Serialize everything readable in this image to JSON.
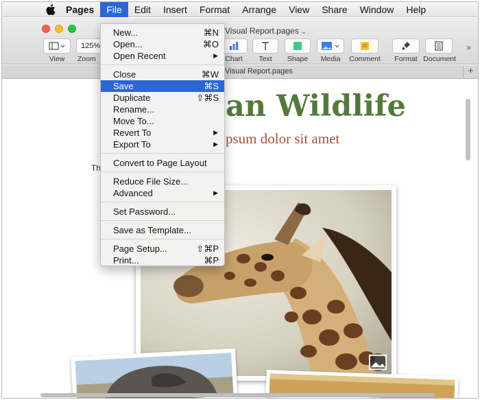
{
  "menubar": {
    "apple_icon": "apple-icon",
    "app_name": "Pages",
    "items": [
      "File",
      "Edit",
      "Insert",
      "Format",
      "Arrange",
      "View",
      "Share",
      "Window",
      "Help"
    ],
    "active": "File"
  },
  "window": {
    "title": "Visual Report.pages",
    "title_chevron": "chevron-down-icon",
    "tab_title": "Visual Report.pages"
  },
  "toolbar": {
    "view_label": "View",
    "zoom_value": "125%",
    "zoom_label": "Zoom",
    "chart_label": "Chart",
    "text_label": "Text",
    "shape_label": "Shape",
    "media_label": "Media",
    "comment_label": "Comment",
    "format_label": "Format",
    "document_label": "Document",
    "more_glyph": "»",
    "accent_color": "#2b66d6"
  },
  "file_menu": {
    "groups": [
      [
        {
          "label": "New...",
          "shortcut": "⌘N"
        },
        {
          "label": "Open...",
          "shortcut": "⌘O"
        },
        {
          "label": "Open Recent",
          "submenu": "▶"
        }
      ],
      [
        {
          "label": "Close",
          "shortcut": "⌘W"
        },
        {
          "label": "Save",
          "shortcut": "⌘S",
          "highlighted": true
        },
        {
          "label": "Duplicate",
          "shortcut": "⇧⌘S"
        },
        {
          "label": "Rename..."
        },
        {
          "label": "Move To..."
        },
        {
          "label": "Revert To",
          "submenu": "▶"
        },
        {
          "label": "Export To",
          "submenu": "▶"
        }
      ],
      [
        {
          "label": "Convert to Page Layout"
        }
      ],
      [
        {
          "label": "Reduce File Size..."
        },
        {
          "label": "Advanced",
          "submenu": "▶"
        }
      ],
      [
        {
          "label": "Set Password..."
        }
      ],
      [
        {
          "label": "Save as Template..."
        }
      ],
      [
        {
          "label": "Page Setup...",
          "shortcut": "⇧⌘P"
        },
        {
          "label": "Print...",
          "shortcut": "⌘P"
        }
      ]
    ]
  },
  "document": {
    "heading_visible": "an Wildlife",
    "subheading_visible": "psum dolor sit amet",
    "body_fragment": "Th",
    "heading_color": "#537a3c",
    "subheading_color": "#a5523a",
    "image_badge_icon": "image-icon"
  }
}
